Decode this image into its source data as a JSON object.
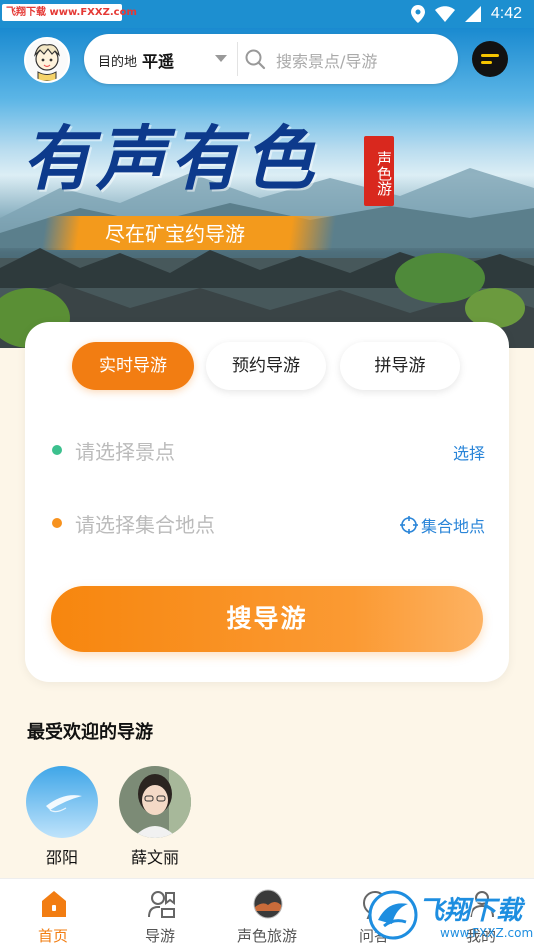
{
  "status_bar": {
    "watermark": "飞翔下载 www.FXXZ.com",
    "time": "4:42"
  },
  "hero": {
    "title": "有声有色",
    "seal_text": "声色游",
    "subtitle": "尽在矿宝约导游"
  },
  "top_bar": {
    "destination_label": "目的地",
    "destination_value": "平遥",
    "search_placeholder": "搜索景点/导游"
  },
  "booking": {
    "tabs": [
      {
        "label": "实时导游",
        "active": true
      },
      {
        "label": "预约导游",
        "active": false
      },
      {
        "label": "拼导游",
        "active": false
      }
    ],
    "spot_field": {
      "placeholder": "请选择景点",
      "action": "选择",
      "dot_color": "#3cc08e"
    },
    "meeting_field": {
      "placeholder": "请选择集合地点",
      "action": "集合地点",
      "dot_color": "#f7921e"
    },
    "search_button": "搜导游"
  },
  "popular": {
    "title": "最受欢迎的导游",
    "guides": [
      {
        "name": "邵阳"
      },
      {
        "name": "薛文丽"
      }
    ]
  },
  "bottom_nav": {
    "items": [
      {
        "label": "首页",
        "icon": "home-icon",
        "active": true
      },
      {
        "label": "导游",
        "icon": "guide-icon",
        "active": false
      },
      {
        "label": "声色旅游",
        "icon": "travel-icon",
        "active": false
      },
      {
        "label": "问答",
        "icon": "qa-icon",
        "active": false
      },
      {
        "label": "我的",
        "icon": "profile-icon",
        "active": false
      }
    ]
  },
  "watermark_logo": {
    "text": "飞翔下载",
    "sub": "www.FXXZ.com"
  },
  "colors": {
    "accent": "#f27d12",
    "link": "#2a85d8",
    "status_bar": "#1d8fd0"
  }
}
